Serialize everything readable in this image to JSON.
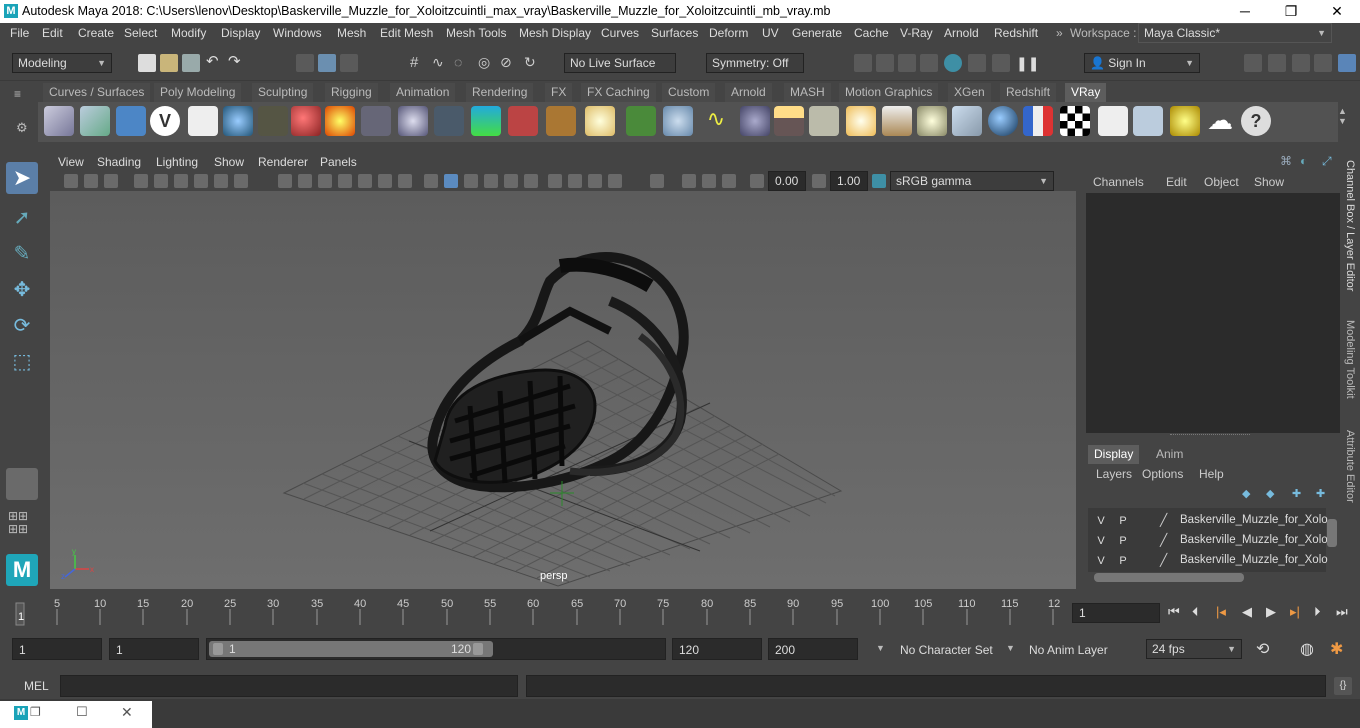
{
  "window": {
    "title": "Autodesk Maya 2018: C:\\Users\\lenov\\Desktop\\Baskerville_Muzzle_for_Xoloitzcuintli_max_vray\\Baskerville_Muzzle_for_Xoloitzcuintli_mb_vray.mb",
    "minimize": "─",
    "maximize": "❐",
    "close": "✕"
  },
  "menu": [
    "File",
    "Edit",
    "Create",
    "Select",
    "Modify",
    "Display",
    "Windows",
    "Mesh",
    "Edit Mesh",
    "Mesh Tools",
    "Mesh Display",
    "Curves",
    "Surfaces",
    "Deform",
    "UV",
    "Generate",
    "Cache",
    "V-Ray",
    "Arnold",
    "Redshift"
  ],
  "workspace": {
    "label": "Workspace :",
    "value": "Maya Classic*"
  },
  "status": {
    "mode": "Modeling",
    "live_surface": "No Live Surface",
    "symmetry": "Symmetry: Off",
    "sign_in": "Sign In"
  },
  "shelf_tabs": [
    "Curves / Surfaces",
    "Poly Modeling",
    "Sculpting",
    "Rigging",
    "Animation",
    "Rendering",
    "FX",
    "FX Caching",
    "Custom",
    "Arnold",
    "MASH",
    "Motion Graphics",
    "XGen",
    "Redshift",
    "VRay"
  ],
  "active_shelf": "VRay",
  "panel_menu": [
    "View",
    "Shading",
    "Lighting",
    "Show",
    "Renderer",
    "Panels"
  ],
  "panel_toolbar": {
    "exposure": "0.00",
    "gamma": "1.00",
    "color_space": "sRGB gamma"
  },
  "viewport": {
    "camera_label": "persp"
  },
  "channel_box": {
    "menu": [
      "Channels",
      "Edit",
      "Object",
      "Show"
    ]
  },
  "layer_editor": {
    "tabs": [
      "Display",
      "Anim"
    ],
    "menu": [
      "Layers",
      "Options",
      "Help"
    ],
    "layers": [
      {
        "v": "V",
        "p": "P",
        "name": "Baskerville_Muzzle_for_Xolo"
      },
      {
        "v": "V",
        "p": "P",
        "name": "Baskerville_Muzzle_for_Xolo"
      },
      {
        "v": "V",
        "p": "P",
        "name": "Baskerville_Muzzle_for_Xolo"
      }
    ]
  },
  "side_tabs": [
    "Channel Box / Layer Editor",
    "Modeling Toolkit",
    "Attribute Editor"
  ],
  "time_slider": {
    "ticks": [
      "5",
      "10",
      "15",
      "20",
      "25",
      "30",
      "35",
      "40",
      "45",
      "50",
      "55",
      "60",
      "65",
      "70",
      "75",
      "80",
      "85",
      "90",
      "95",
      "100",
      "105",
      "110",
      "115",
      "12"
    ],
    "start_marker": "1",
    "current_frame": "1"
  },
  "range": {
    "start": "1",
    "playback_start": "1",
    "slider_start": "1",
    "slider_end": "120",
    "playback_end": "120",
    "end": "200",
    "character_set": "No Character Set",
    "anim_layer": "No Anim Layer",
    "fps": "24 fps"
  },
  "command_line": {
    "label": "MEL"
  }
}
